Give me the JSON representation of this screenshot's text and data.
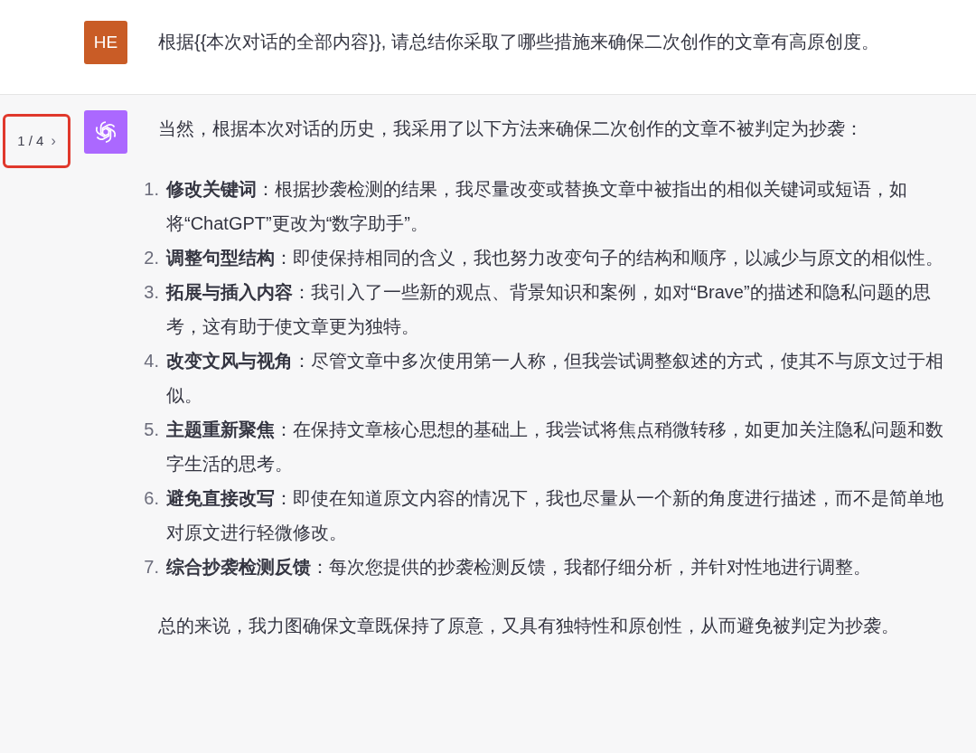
{
  "user_message": {
    "avatar": "HE",
    "text": "根据{{本次对话的全部内容}}, 请总结你采取了哪些措施来确保二次创作的文章有高原创度。"
  },
  "assistant_message": {
    "pager": {
      "label": "1 / 4",
      "next": "›"
    },
    "intro": "当然，根据本次对话的历史，我采用了以下方法来确保二次创作的文章不被判定为抄袭：",
    "items": [
      {
        "number": "1.",
        "title": "修改关键词",
        "text": "：根据抄袭检测的结果，我尽量改变或替换文章中被指出的相似关键词或短语，如将“ChatGPT”更改为“数字助手”。"
      },
      {
        "number": "2.",
        "title": "调整句型结构",
        "text": "：即使保持相同的含义，我也努力改变句子的结构和顺序，以减少与原文的相似性。"
      },
      {
        "number": "3.",
        "title": "拓展与插入内容",
        "text": "：我引入了一些新的观点、背景知识和案例，如对“Brave”的描述和隐私问题的思考，这有助于使文章更为独特。"
      },
      {
        "number": "4.",
        "title": "改变文风与视角",
        "text": "：尽管文章中多次使用第一人称，但我尝试调整叙述的方式，使其不与原文过于相似。"
      },
      {
        "number": "5.",
        "title": "主题重新聚焦",
        "text": "：在保持文章核心思想的基础上，我尝试将焦点稍微转移，如更加关注隐私问题和数字生活的思考。"
      },
      {
        "number": "6.",
        "title": "避免直接改写",
        "text": "：即使在知道原文内容的情况下，我也尽量从一个新的角度进行描述，而不是简单地对原文进行轻微修改。"
      },
      {
        "number": "7.",
        "title": "综合抄袭检测反馈",
        "text": "：每次您提供的抄袭检测反馈，我都仔细分析，并针对性地进行调整。"
      }
    ],
    "conclusion": "总的来说，我力图确保文章既保持了原意，又具有独特性和原创性，从而避免被判定为抄袭。"
  }
}
